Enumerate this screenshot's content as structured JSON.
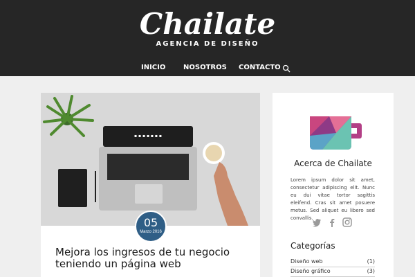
{
  "header": {
    "logo_text": "Chailate",
    "tagline": "AGENCIA DE DISEÑO",
    "nav": [
      "INICIO",
      "NOSOTROS",
      "CONTACTO"
    ]
  },
  "post": {
    "date_day": "05",
    "date_month": "Marzo 2016",
    "title": "Mejora los ingresos de tu negocio  teniendo un página web"
  },
  "sidebar": {
    "about_title": "Acerca de Chailate",
    "about_text": "Lorem ipsum dolor sit amet, consectetur adipiscing elit. Nunc eu dui vitae tortor sagittis eleifend. Cras sit amet posuere metus. Sed aliquet eu libero sed convallis.",
    "social_icons": [
      "twitter-icon",
      "facebook-icon",
      "instagram-icon"
    ],
    "categories_title": "Categorías",
    "categories": [
      {
        "label": "Diseño web",
        "count": "(1)"
      },
      {
        "label": "Diseño gráfico",
        "count": "(3)"
      }
    ]
  },
  "colors": {
    "header_bg": "#262626",
    "badge_bg": "#2f5e86",
    "page_bg": "#efefef"
  }
}
